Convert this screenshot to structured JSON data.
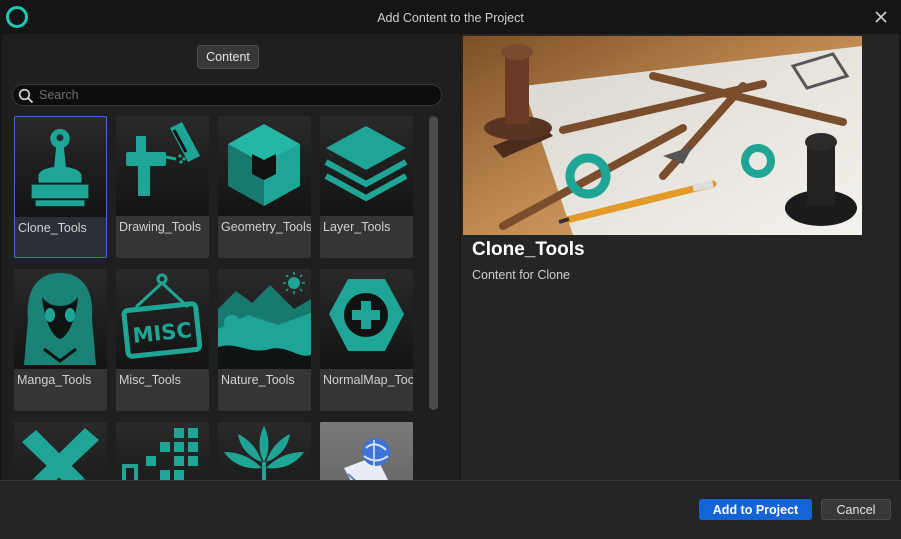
{
  "window": {
    "title": "Add Content to the Project"
  },
  "filter": {
    "content_label": "Content"
  },
  "search": {
    "placeholder": "Search",
    "value": ""
  },
  "tiles": [
    {
      "label": "Clone_Tools",
      "icon": "stamp-icon",
      "selected": true
    },
    {
      "label": "Drawing_Tools",
      "icon": "airbrush-icon"
    },
    {
      "label": "Geometry_Tools",
      "icon": "cube-icon"
    },
    {
      "label": "Layer_Tools",
      "icon": "layers-icon"
    },
    {
      "label": "Manga_Tools",
      "icon": "manga-girl-icon"
    },
    {
      "label": "Misc_Tools",
      "icon": "misc-sign-icon"
    },
    {
      "label": "Nature_Tools",
      "icon": "landscape-icon"
    },
    {
      "label": "NormalMap_Tools",
      "icon": "normalmap-plus-icon"
    },
    {
      "label": "",
      "icon": "brush-cross-icon"
    },
    {
      "label": "",
      "icon": "pixel-grid-icon"
    },
    {
      "label": "",
      "icon": "fern-icon"
    },
    {
      "label": "",
      "icon": "package-globe-icon"
    }
  ],
  "detail": {
    "title": "Clone_Tools",
    "description": "Content for Clone"
  },
  "footer": {
    "add_label": "Add to Project",
    "cancel_label": "Cancel"
  },
  "colors": {
    "accent_teal": "#1fa595",
    "primary_blue": "#1464d8",
    "selection_border": "#3b6fd4"
  }
}
